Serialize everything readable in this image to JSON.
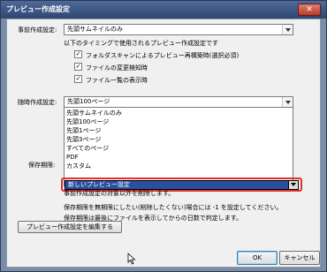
{
  "window": {
    "title": "プレビュー作成設定",
    "close_glyph": "✕"
  },
  "advance": {
    "label": "事前作成設定:",
    "value": "先頭サムネイルのみ",
    "note": "以下のタイミングで使用されるプレビュー作成設定です",
    "options": [
      {
        "label": "フォルダスキャンによるプレビュー再構築時(選択必須)",
        "checked": true
      },
      {
        "label": "ファイルの変更検知時",
        "checked": true
      },
      {
        "label": "ファイル一覧の表示時",
        "checked": true
      }
    ]
  },
  "ondemand": {
    "label": "随時作成設定:",
    "value": "先頭100ページ",
    "list": [
      "先頭サムネイルのみ",
      "先頭100ページ",
      "先頭1ページ",
      "先頭3ページ",
      "すべてのページ",
      "PDF",
      "カスタム"
    ],
    "selected": "新しいプレビュー設定"
  },
  "retention": {
    "label": "保存期限:",
    "lines": [
      "事前作成設定の対象以外を削除します。",
      "保存期限を無期限にしたい(削除したくない)場合には -1 を設定してください。",
      "保存期限は最後にファイルを表示してからの日数で判定します。"
    ]
  },
  "buttons": {
    "edit": "プレビュー作成設定を編集する",
    "ok": "OK",
    "cancel": "キャンセル"
  }
}
